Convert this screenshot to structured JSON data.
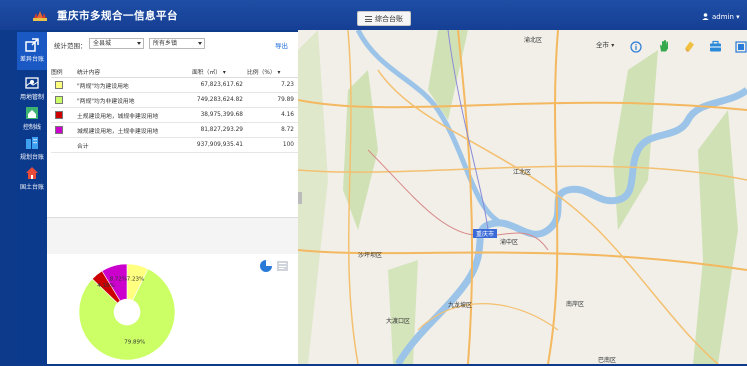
{
  "header": {
    "title": "重庆市多规合一信息平台",
    "center_button": "综合台账",
    "user": "admin",
    "colors": {
      "bar": "#1a4aa0",
      "sidebar": "#0b3a8c",
      "active": "#1a59c4"
    }
  },
  "sidebar": {
    "items": [
      {
        "label": "差异台账",
        "icon": "share-icon"
      },
      {
        "label": "用地管制",
        "icon": "map-pin-icon"
      },
      {
        "label": "控制线",
        "icon": "home-icon"
      },
      {
        "label": "规划台账",
        "icon": "building-icon"
      },
      {
        "label": "国土台账",
        "icon": "house-icon"
      }
    ]
  },
  "filter": {
    "label": "统计范围：",
    "scope_select": "全县城",
    "town_select": "所有乡镇",
    "export": "导出"
  },
  "table": {
    "headers": [
      "图例",
      "统计内容",
      "面积（㎡）",
      "比例（%）"
    ],
    "rows": [
      {
        "color": "#ffff80",
        "content": "\"两规\"均为建设用地",
        "area": "67,823,617.62",
        "ratio": "7.23"
      },
      {
        "color": "#ccff66",
        "content": "\"两规\"均为非建设用地",
        "area": "749,283,624.82",
        "ratio": "79.89"
      },
      {
        "color": "#cc0000",
        "content": "土规建设用地，城规非建设用地",
        "area": "38,975,399.68",
        "ratio": "4.16"
      },
      {
        "color": "#cc00cc",
        "content": "城规建设用地，土规非建设用地",
        "area": "81,827,293.29",
        "ratio": "8.72"
      },
      {
        "color": "",
        "content": "合计",
        "area": "937,909,935.41",
        "ratio": "100"
      }
    ]
  },
  "chart_data": {
    "type": "pie",
    "categories": [
      "\"两规\"均为建设用地",
      "\"两规\"均为非建设用地",
      "土规建设用地，城规非建设用地",
      "城规建设用地，土规非建设用地"
    ],
    "values": [
      7.23,
      79.89,
      4.16,
      8.72
    ],
    "colors": [
      "#ffff80",
      "#ccff66",
      "#cc0000",
      "#cc00cc"
    ],
    "labels": [
      "7.23%",
      "79.89%",
      "4.16%",
      "8.72%"
    ]
  },
  "map": {
    "scope": "全市",
    "places": [
      "重庆市",
      "渝北区",
      "江北区",
      "渝中区",
      "沙坪坝区",
      "九龙坡区",
      "大渡口区",
      "南岸区",
      "巴南区"
    ]
  }
}
